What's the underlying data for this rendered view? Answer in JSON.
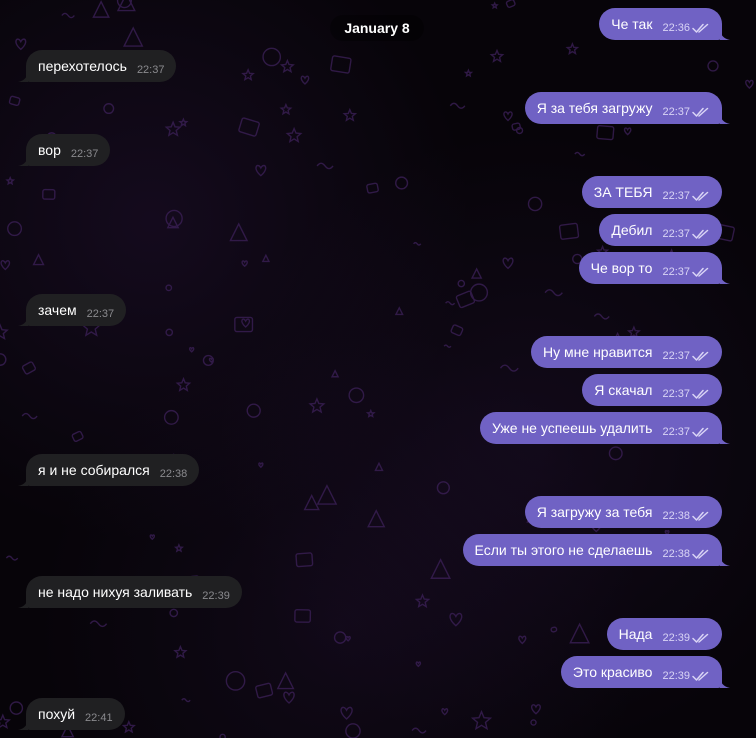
{
  "date_header": "January 8",
  "colors": {
    "incoming": "#202022",
    "outgoing": "#7062c4",
    "background": "#070409"
  },
  "messages": [
    {
      "dir": "out",
      "text": "Че так",
      "time": "22:36",
      "read_icon": "double-check-icon"
    },
    {
      "dir": "in",
      "text": "перехотелось",
      "time": "22:37"
    },
    {
      "dir": "out",
      "text": "Я за тебя загружу",
      "time": "22:37",
      "read_icon": "double-check-icon"
    },
    {
      "dir": "in",
      "text": "вор",
      "time": "22:37"
    },
    {
      "dir": "out",
      "text": "ЗА ТЕБЯ",
      "time": "22:37",
      "read_icon": "double-check-icon"
    },
    {
      "dir": "out",
      "text": "Дебил",
      "time": "22:37",
      "read_icon": "double-check-icon"
    },
    {
      "dir": "out",
      "text": "Че вор то",
      "time": "22:37",
      "read_icon": "double-check-icon"
    },
    {
      "dir": "in",
      "text": "зачем",
      "time": "22:37"
    },
    {
      "dir": "out",
      "text": "Ну мне нравится",
      "time": "22:37",
      "read_icon": "double-check-icon"
    },
    {
      "dir": "out",
      "text": "Я скачал",
      "time": "22:37",
      "read_icon": "double-check-icon"
    },
    {
      "dir": "out",
      "text": "Уже не успеешь удалить",
      "time": "22:37",
      "read_icon": "double-check-icon"
    },
    {
      "dir": "in",
      "text": "я и не собирался",
      "time": "22:38"
    },
    {
      "dir": "out",
      "text": "Я загружу за тебя",
      "time": "22:38",
      "read_icon": "double-check-icon"
    },
    {
      "dir": "out",
      "text": "Если ты этого не сделаешь",
      "time": "22:38",
      "read_icon": "double-check-icon"
    },
    {
      "dir": "in",
      "text": "не надо нихуя заливать",
      "time": "22:39"
    },
    {
      "dir": "out",
      "text": "Нада",
      "time": "22:39",
      "read_icon": "double-check-icon"
    },
    {
      "dir": "out",
      "text": "Это красиво",
      "time": "22:39",
      "read_icon": "double-check-icon"
    },
    {
      "dir": "in",
      "text": "похуй",
      "time": "22:41"
    }
  ]
}
